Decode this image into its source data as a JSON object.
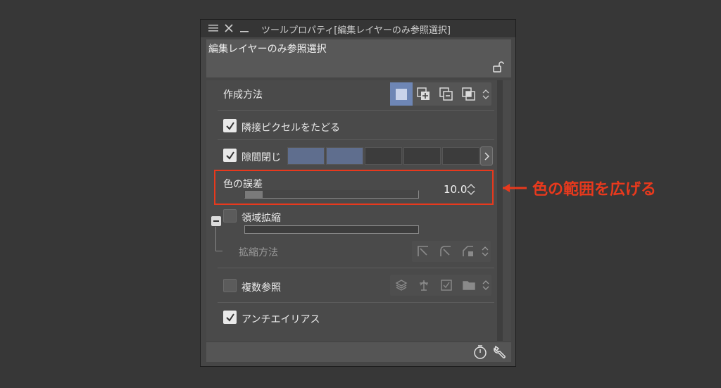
{
  "titlebar": {
    "menu_icon": "hamburger-icon",
    "close_icon": "close-icon",
    "minimize_icon": "minimize-icon",
    "title": "ツールプロパティ[編集レイヤーのみ参照選択]"
  },
  "header": {
    "name": "編集レイヤーのみ参照選択",
    "lock_icon": "unlock-icon"
  },
  "creation_method": {
    "label": "作成方法",
    "modes": [
      "new-selection",
      "add-selection",
      "subtract-selection",
      "intersect-selection"
    ],
    "active": 0
  },
  "trace_adjacent": {
    "label": "隣接ピクセルをたどる",
    "checked": true
  },
  "gap_close": {
    "label": "隙間閉じ",
    "checked": true,
    "levels_on": 2,
    "levels_total": 5
  },
  "color_tolerance": {
    "label": "色の誤差",
    "value": "10.0",
    "fraction": 0.1
  },
  "area_scaling": {
    "label": "領域拡縮",
    "checked": false,
    "method_label": "拡縮方法"
  },
  "multi_reference": {
    "label": "複数参照",
    "checked": false
  },
  "antialias": {
    "label": "アンチエイリアス",
    "checked": true
  },
  "annotation": {
    "text": "色の範囲を広げる",
    "color": "#e8391d"
  },
  "footer": {
    "icons": [
      "timer-icon",
      "wrench-icon"
    ]
  },
  "colors": {
    "accent": "#6e86b5",
    "highlight": "#e8391d"
  }
}
